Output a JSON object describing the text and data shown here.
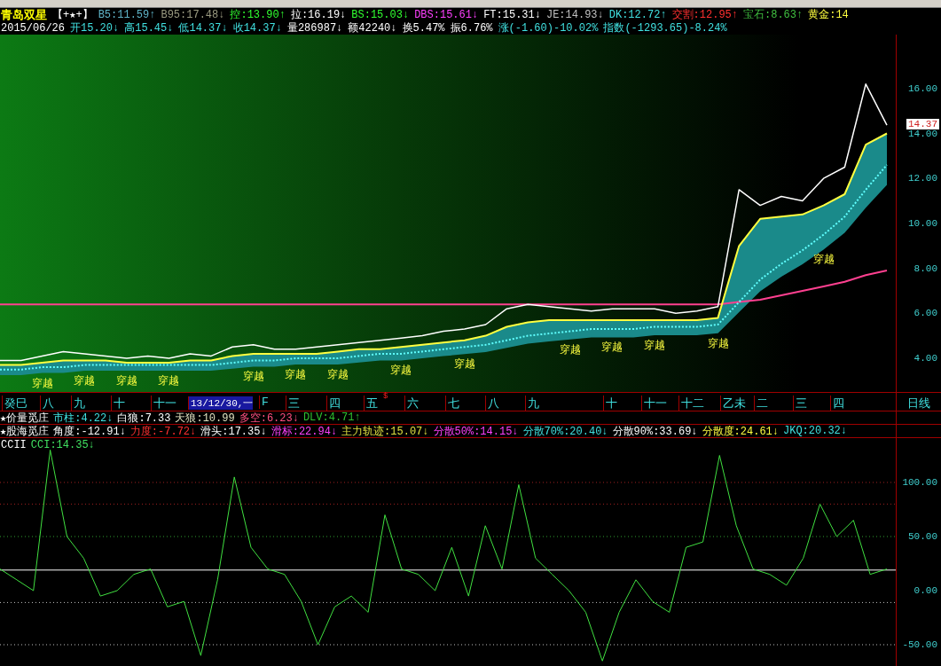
{
  "quote_header": {
    "items": [
      {
        "text": "青岛双星",
        "color": "#ffff00"
      },
      {
        "text": "【+★+】",
        "color": "#ffffff"
      },
      {
        "text": "B5:11.59↑",
        "color": "#5fb4c8"
      },
      {
        "text": "B95:17.48↓",
        "color": "#9a9a80"
      },
      {
        "text": "控:13.90↑",
        "color": "#30ff30"
      },
      {
        "text": "拉:16.19↓",
        "color": "#ffffff"
      },
      {
        "text": "BS:15.03↓",
        "color": "#30ff30"
      },
      {
        "text": "DBS:15.61↓",
        "color": "#ff40ff"
      },
      {
        "text": "FT:15.31↓",
        "color": "#ffffff"
      },
      {
        "text": "JE:14.93↓",
        "color": "#c0c0c0"
      },
      {
        "text": "DK:12.72↑",
        "color": "#40e0e0"
      },
      {
        "text": "交割:12.95↑",
        "color": "#ff3030"
      },
      {
        "text": "宝石:8.63↑",
        "color": "#40c040"
      },
      {
        "text": "黄金:14",
        "color": "#ffff40"
      }
    ]
  },
  "quote_line": {
    "items": [
      {
        "text": "2015/06/26",
        "color": "#ffffff"
      },
      {
        "text": "开15.20↓",
        "color": "#40e0e0"
      },
      {
        "text": "高15.45↓",
        "color": "#40e0e0"
      },
      {
        "text": "低14.37↓",
        "color": "#40e0e0"
      },
      {
        "text": "收14.37↓",
        "color": "#40e0e0"
      },
      {
        "text": "量286987↓",
        "color": "#ffffff"
      },
      {
        "text": "额42240↓",
        "color": "#ffffff"
      },
      {
        "text": "换5.47%",
        "color": "#ffffff"
      },
      {
        "text": "振6.76%",
        "color": "#ffffff"
      },
      {
        "text": "涨(-1.60)-10.02%",
        "color": "#40e0e0"
      },
      {
        "text": "指数(-1293.65)-8.24%",
        "color": "#40e0e0"
      }
    ]
  },
  "price_panel": {
    "current_price": "14.37",
    "signal_labels": [
      "穿越",
      "穿越",
      "穿越",
      "穿越",
      "穿越",
      "穿越",
      "穿越",
      "穿越",
      "穿越",
      "穿越",
      "穿越",
      "穿越",
      "穿越",
      "穿越"
    ],
    "chart_data": {
      "type": "line",
      "series": [
        {
          "color": "#ffffff",
          "values": [
            3.9,
            3.9,
            4.1,
            4.3,
            4.2,
            4.1,
            4.0,
            4.1,
            4.0,
            4.2,
            4.1,
            4.5,
            4.6,
            4.4,
            4.4,
            4.5,
            4.6,
            4.7,
            4.8,
            4.9,
            5.0,
            5.2,
            5.3,
            5.5,
            6.2,
            6.4,
            6.3,
            6.2,
            6.1,
            6.2,
            6.2,
            6.2,
            6.0,
            6.1,
            6.3,
            11.5,
            10.8,
            11.2,
            11.0,
            12.0,
            12.5,
            16.2,
            14.37
          ]
        },
        {
          "color": "#ffff40",
          "values": [
            3.7,
            3.7,
            3.8,
            3.9,
            3.9,
            3.9,
            3.8,
            3.8,
            3.8,
            3.9,
            3.9,
            4.1,
            4.2,
            4.2,
            4.2,
            4.2,
            4.3,
            4.4,
            4.4,
            4.5,
            4.6,
            4.7,
            4.8,
            5.0,
            5.4,
            5.6,
            5.7,
            5.7,
            5.7,
            5.7,
            5.7,
            5.7,
            5.7,
            5.7,
            5.8,
            9.0,
            10.2,
            10.3,
            10.4,
            10.8,
            11.3,
            13.5,
            14.0
          ]
        },
        {
          "color": "#60ffff",
          "line_style": "dashed",
          "values": [
            3.5,
            3.5,
            3.6,
            3.6,
            3.7,
            3.7,
            3.7,
            3.7,
            3.7,
            3.7,
            3.7,
            3.8,
            3.9,
            3.9,
            4.0,
            4.0,
            4.0,
            4.1,
            4.2,
            4.2,
            4.3,
            4.4,
            4.5,
            4.6,
            4.8,
            5.0,
            5.1,
            5.2,
            5.3,
            5.3,
            5.3,
            5.4,
            5.4,
            5.4,
            5.5,
            6.5,
            7.5,
            8.2,
            8.8,
            9.5,
            10.3,
            11.5,
            12.6
          ]
        },
        {
          "color": "#ff4090",
          "values": [
            6.4,
            6.4,
            6.4,
            6.4,
            6.4,
            6.4,
            6.4,
            6.4,
            6.4,
            6.4,
            6.4,
            6.4,
            6.4,
            6.4,
            6.4,
            6.4,
            6.4,
            6.4,
            6.4,
            6.4,
            6.4,
            6.4,
            6.4,
            6.4,
            6.4,
            6.4,
            6.4,
            6.4,
            6.4,
            6.4,
            6.4,
            6.4,
            6.4,
            6.4,
            6.4,
            6.5,
            6.6,
            6.8,
            7.0,
            7.2,
            7.4,
            7.7,
            7.9
          ]
        }
      ],
      "ylim": [
        2.5,
        18.4
      ],
      "yticks": [
        {
          "value": 4,
          "label": "4.00"
        },
        {
          "value": 6,
          "label": "6.00"
        },
        {
          "value": 8,
          "label": "8.00"
        },
        {
          "value": 10,
          "label": "10.00"
        },
        {
          "value": 12,
          "label": "12.00"
        },
        {
          "value": 14,
          "label": "14.00"
        },
        {
          "value": 16,
          "label": "16.00"
        }
      ]
    }
  },
  "time_axis": {
    "marker": "$",
    "period": "日线",
    "labels": [
      {
        "text": "癸巳",
        "selected": false
      },
      {
        "text": "八",
        "selected": false
      },
      {
        "text": "九",
        "selected": false
      },
      {
        "text": "十",
        "selected": false
      },
      {
        "text": "十一",
        "selected": false
      },
      {
        "text": "13/12/30,一",
        "selected": true
      },
      {
        "text": "F",
        "selected": false
      },
      {
        "text": "三",
        "selected": false
      },
      {
        "text": "四",
        "selected": false
      },
      {
        "text": "五",
        "selected": false
      },
      {
        "text": "六",
        "selected": false
      },
      {
        "text": "七",
        "selected": false
      },
      {
        "text": "八",
        "selected": false
      },
      {
        "text": "九",
        "selected": false
      },
      {
        "text": "十",
        "selected": false
      },
      {
        "text": "十一",
        "selected": false
      },
      {
        "text": "十二",
        "selected": false
      },
      {
        "text": "乙未",
        "selected": false
      },
      {
        "text": "二",
        "selected": false
      },
      {
        "text": "三",
        "selected": false
      },
      {
        "text": "四",
        "selected": false
      }
    ]
  },
  "indicator_rows": [
    {
      "title": "★价量觅庄",
      "items": [
        {
          "text": "市柱:4.22↓",
          "color": "#40e0e0"
        },
        {
          "text": "白狼:7.33",
          "color": "#ffffff"
        },
        {
          "text": "天狼:10.99",
          "color": "#e0e0c0"
        },
        {
          "text": "多空:6.23↓",
          "color": "#ff5080"
        },
        {
          "text": "DLV:4.71↑",
          "color": "#30c030"
        }
      ]
    },
    {
      "title": "★股海觅庄",
      "items": [
        {
          "text": "角度:-12.91↓",
          "color": "#ffffff"
        },
        {
          "text": "力度:-7.72↓",
          "color": "#ff3030"
        },
        {
          "text": "滑头:17.35↓",
          "color": "#ffffff"
        },
        {
          "text": "滑标:22.94↓",
          "color": "#ff40ff"
        },
        {
          "text": "主力轨迹:15.07↓",
          "color": "#e0e040"
        },
        {
          "text": "分散50%:14.15↓",
          "color": "#ff40ff"
        },
        {
          "text": "分散70%:20.40↓",
          "color": "#40e0e0"
        },
        {
          "text": "分散90%:33.69↓",
          "color": "#ffffff"
        },
        {
          "text": "分散度:24.61↓",
          "color": "#ffff40"
        },
        {
          "text": "JKQ:20.32↓",
          "color": "#40e0e0"
        }
      ]
    }
  ],
  "cci_panel": {
    "title": "CCII",
    "reading": "CCI:14.35↓",
    "chart_data": {
      "type": "line",
      "series": [
        {
          "color": "#40e040",
          "values": [
            20,
            10,
            0,
            130,
            50,
            30,
            -5,
            0,
            15,
            20,
            -15,
            -10,
            -60,
            10,
            105,
            40,
            20,
            15,
            -10,
            -50,
            -15,
            -5,
            -20,
            70,
            20,
            15,
            0,
            40,
            -5,
            60,
            20,
            98,
            30,
            15,
            0,
            -20,
            -65,
            -20,
            10,
            -10,
            -20,
            40,
            45,
            125,
            60,
            20,
            15,
            5,
            30,
            80,
            50,
            65,
            15,
            20
          ]
        }
      ],
      "ylim": [
        -70.5,
        141
      ],
      "yticks": [
        {
          "value": -50,
          "label": "-50.00"
        },
        {
          "value": 0,
          "label": "0.00"
        },
        {
          "value": 50,
          "label": "50.00"
        },
        {
          "value": 100,
          "label": "100.00"
        }
      ]
    }
  }
}
